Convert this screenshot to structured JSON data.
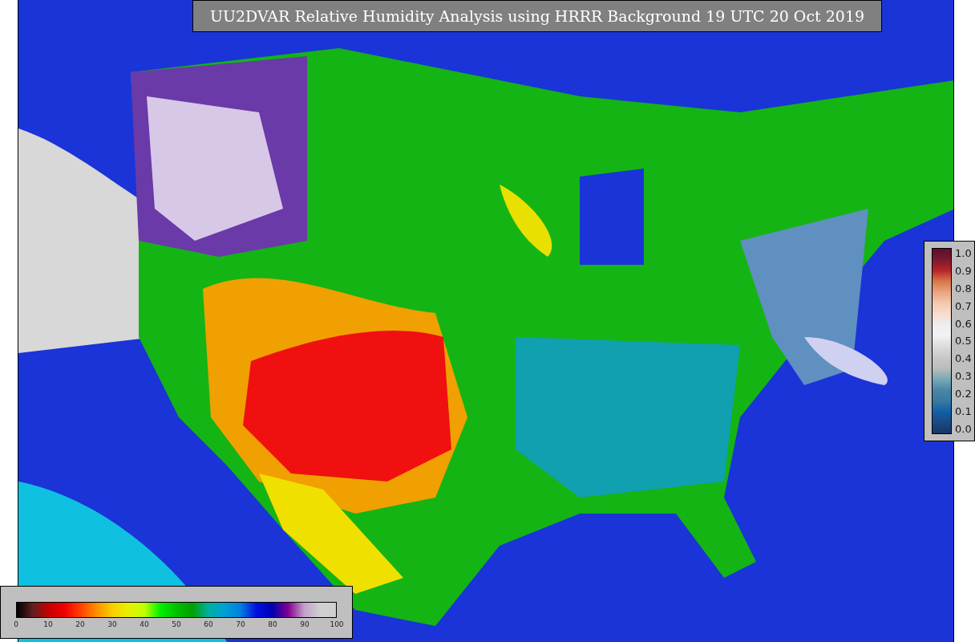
{
  "title": "UU2DVAR Relative Humidity Analysis using HRRR Background 19 UTC 20 Oct 2019",
  "colorbars": [
    {
      "kind": "vertical",
      "labels": [
        "1.0",
        "0.9",
        "0.8",
        "0.7",
        "0.6",
        "0.5",
        "0.4",
        "0.3",
        "0.2",
        "0.1",
        "0.0"
      ]
    },
    {
      "kind": "horizontal",
      "labels": [
        "0",
        "10",
        "20",
        "30",
        "40",
        "50",
        "60",
        "70",
        "80",
        "90",
        "100"
      ]
    }
  ]
}
